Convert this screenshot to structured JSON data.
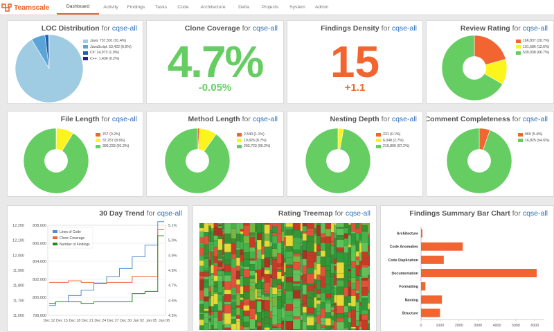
{
  "app": {
    "name": "Teamscale"
  },
  "nav": {
    "tabs": [
      {
        "label": "Dashboard",
        "active": true
      },
      {
        "label": "Activity"
      },
      {
        "label": "Findings"
      },
      {
        "label": "Tasks"
      },
      {
        "label": "Code"
      },
      {
        "label": "Architecture"
      },
      {
        "label": "Delta"
      },
      {
        "label": "Projects"
      },
      {
        "label": "System"
      },
      {
        "label": "Admin"
      }
    ]
  },
  "colors": {
    "red": "#f26531",
    "yellow": "#fbf51d",
    "green": "#66cd63",
    "blue_light": "#9fcbe3",
    "blue_mid": "#5aa4d7",
    "blue_dark": "#1f5fae",
    "navy": "#26218f",
    "accent": "#e8672b"
  },
  "widgets": {
    "loc": {
      "title": "LOC Distribution",
      "for": "for",
      "project": "cqse-all",
      "legend": [
        {
          "label": "Java: 737,301 (91.4%)",
          "value": 737301,
          "color": "#9fcbe3"
        },
        {
          "label": "JavaScript: 53,422 (6.6%)",
          "value": 53422,
          "color": "#5aa4d7"
        },
        {
          "label": "C#: 14,973 (1.9%)",
          "value": 14973,
          "color": "#1f5fae"
        },
        {
          "label": "C++: 1,436 (0.2%)",
          "value": 1436,
          "color": "#26218f"
        }
      ]
    },
    "clone": {
      "title": "Clone Coverage",
      "for": "for",
      "project": "cqse-all",
      "value": "4.7%",
      "delta": "-0.05%"
    },
    "density": {
      "title": "Findings Density",
      "for": "for",
      "project": "cqse-all",
      "value": "15",
      "delta": "+1.1"
    },
    "review": {
      "title": "Review Rating",
      "for": "for",
      "project": "cqse-all",
      "legend": [
        {
          "label": "166,837 (20.7%)",
          "value": 20.7,
          "color": "#f26531"
        },
        {
          "label": "101,686 (12.6%)",
          "value": 12.6,
          "color": "#fbf51d"
        },
        {
          "label": "539,038 (66.7%)",
          "value": 66.7,
          "color": "#66cd63"
        }
      ]
    },
    "file_length": {
      "title": "File Length",
      "for": "for",
      "project": "cqse-all",
      "legend": [
        {
          "label": "767 (0.2%)",
          "value": 0.2,
          "color": "#f26531"
        },
        {
          "label": "37,257 (8.6%)",
          "value": 8.6,
          "color": "#fbf51d"
        },
        {
          "label": "396,233 (91.2%)",
          "value": 91.2,
          "color": "#66cd63"
        }
      ]
    },
    "method_length": {
      "title": "Method Length",
      "for": "for",
      "project": "cqse-all",
      "legend": [
        {
          "label": "2,540 (1.1%)",
          "value": 1.1,
          "color": "#f26531"
        },
        {
          "label": "19,825 (8.7%)",
          "value": 8.7,
          "color": "#fbf51d"
        },
        {
          "label": "203,723 (90.2%)",
          "value": 90.2,
          "color": "#66cd63"
        }
      ]
    },
    "nesting": {
      "title": "Nesting Depth",
      "for": "for",
      "project": "cqse-all",
      "legend": [
        {
          "label": "231 (0.1%)",
          "value": 0.1,
          "color": "#f26531"
        },
        {
          "label": "6,048 (2.7%)",
          "value": 2.7,
          "color": "#fbf51d"
        },
        {
          "label": "219,809 (97.2%)",
          "value": 97.2,
          "color": "#66cd63"
        }
      ]
    },
    "comment": {
      "title": "Comment Completeness",
      "for": "for",
      "project": "cqse-all",
      "legend": [
        {
          "label": "969 (5.4%)",
          "value": 5.4,
          "color": "#f26531"
        },
        {
          "label": "16,825 (94.6%)",
          "value": 94.6,
          "color": "#66cd63"
        }
      ]
    },
    "trend": {
      "title": "30 Day Trend",
      "for": "for",
      "project": "cqse-all",
      "legend": [
        {
          "label": "Lines of Code",
          "color": "#4f8fd0"
        },
        {
          "label": "Clone Coverage",
          "color": "#f26531"
        },
        {
          "label": "Number of Findings",
          "color": "#1f8a1f"
        }
      ],
      "left_ticks": [
        "12,200",
        "12,100",
        "12,000",
        "11,900",
        "11,800",
        "11,700",
        "11,600"
      ],
      "mid_ticks": [
        "808,000",
        "806,000",
        "804,000",
        "802,000",
        "800,000",
        "798,000"
      ],
      "right_ticks": [
        "5.1%",
        "5.0%",
        "4.9%",
        "4.8%",
        "4.7%",
        "4.6%",
        "4.5%"
      ],
      "x_ticks": [
        "Dec 12",
        "Dec 15",
        "Dec 18",
        "Dec 21",
        "Dec 24",
        "Dec 27",
        "Dec 30",
        "Jan 02",
        "Jan 05",
        "Jan 08"
      ]
    },
    "treemap": {
      "title": "Rating Treemap",
      "for": "for",
      "project": "cqse-all"
    },
    "findings_bar": {
      "title": "Findings Summary Bar Chart",
      "for": "for",
      "project": "cqse-all",
      "categories": [
        "Architecture",
        "Code Anomalies",
        "Code Duplication",
        "Documentation",
        "Formatting",
        "Naming",
        "Structure"
      ],
      "x_ticks": [
        "0",
        "1000",
        "2000",
        "3000",
        "4000",
        "5000",
        "6000"
      ]
    }
  },
  "chart_data": [
    {
      "type": "line",
      "x": [
        "Dec 12",
        "Dec 15",
        "Dec 18",
        "Dec 21",
        "Dec 24",
        "Dec 27",
        "Dec 30",
        "Jan 02",
        "Jan 05",
        "Jan 08"
      ],
      "series": [
        {
          "name": "Lines of Code",
          "axis": "mid",
          "values": [
            799100,
            799500,
            800200,
            800800,
            801600,
            802300,
            803200,
            804500,
            805800,
            808400
          ]
        },
        {
          "name": "Clone Coverage",
          "axis": "right",
          "values": [
            4.72,
            4.72,
            4.73,
            4.72,
            4.71,
            4.72,
            4.72,
            4.76,
            4.76,
            5.07
          ]
        },
        {
          "name": "Number of Findings",
          "axis": "left",
          "values": [
            11680,
            11690,
            11690,
            11680,
            11690,
            11690,
            11690,
            11745,
            11760,
            12130
          ]
        }
      ],
      "ylim_left": [
        11600,
        12200
      ],
      "ylim_mid": [
        798000,
        808000
      ],
      "ylim_right": [
        4.5,
        5.1
      ]
    },
    {
      "type": "bar",
      "orientation": "horizontal",
      "categories": [
        "Architecture",
        "Code Anomalies",
        "Code Duplication",
        "Documentation",
        "Formatting",
        "Naming",
        "Structure"
      ],
      "values": [
        30,
        2200,
        1200,
        6100,
        230,
        1100,
        1000
      ],
      "xlim": [
        0,
        6500
      ]
    }
  ]
}
